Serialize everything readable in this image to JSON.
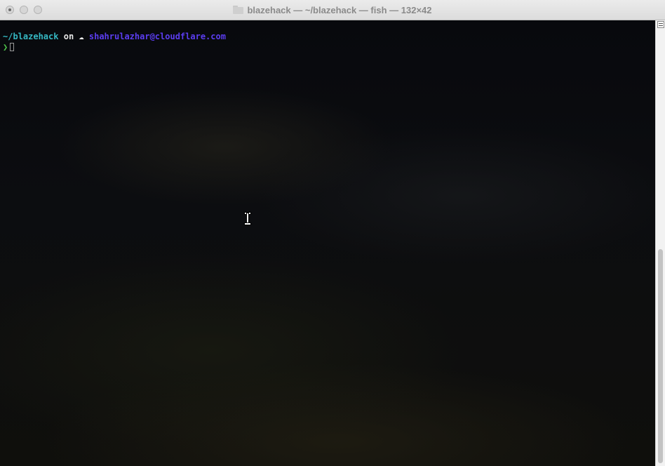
{
  "window": {
    "title": "blazehack — ~/blazehack — fish — 132×42"
  },
  "terminal": {
    "line1": {
      "path": "~/blazehack",
      "on": "on",
      "cloud_glyph": "☁",
      "account": "shahrulazhar@cloudflare.com"
    },
    "line2": {
      "prompt_glyph": "❯",
      "input_value": ""
    },
    "colors": {
      "path": "#35b7c2",
      "account": "#5b3df0",
      "prompt": "#4ec44a"
    }
  },
  "scrollbar": {
    "position_fraction": 0.52
  }
}
